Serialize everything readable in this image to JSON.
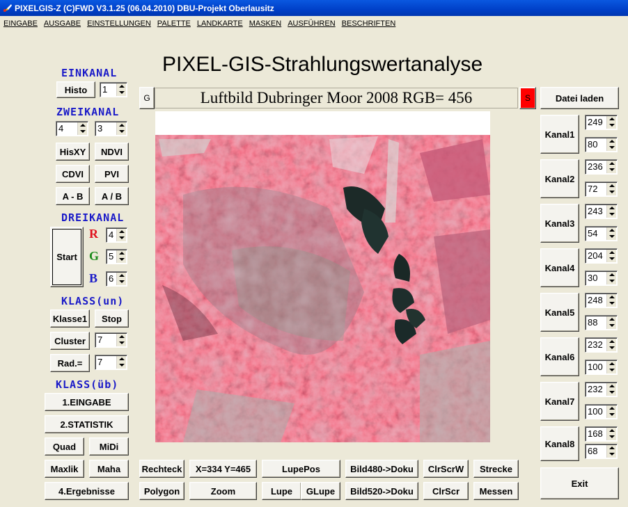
{
  "window": {
    "title": "PIXELGIS-Z (C)FWD V3.1.25 (06.04.2010)  DBU-Projekt Oberlausitz"
  },
  "menu": [
    "EINGABE",
    "AUSGABE",
    "EINSTELLUNGEN",
    "PALETTE",
    "LANDKARTE",
    "MASKEN",
    "AUSFÜHREN",
    "BESCHRIFTEN"
  ],
  "main_title": "PIXEL-GIS-Strahlungswertanalyse",
  "image": {
    "caption": "Luftbild Dubringer Moor 2008 RGB= 456",
    "g_label": "G",
    "s_label": "S"
  },
  "left": {
    "einkanal": "EINKANAL",
    "histo": "Histo",
    "histo_val": "1",
    "zweikanal": "ZWEIKANAL",
    "z1": "4",
    "z2": "3",
    "hisxy": "HisXY",
    "ndvi": "NDVI",
    "cdvi": "CDVI",
    "pvi": "PVI",
    "amb": "A - B",
    "adb": "A / B",
    "dreikanal": "DREIKANAL",
    "start": "Start",
    "r": "R",
    "g": "G",
    "b": "B",
    "r_val": "4",
    "g_val": "5",
    "b_val": "6",
    "klass_un": "KLASS(un)",
    "klasse1": "Klasse1",
    "stop": "Stop",
    "cluster": "Cluster",
    "cluster_val": "7",
    "rad": "Rad.=",
    "rad_val": "7",
    "klass_ub": "KLASS(üb)",
    "eingabe": "1.EINGABE",
    "statistik": "2.STATISTIK",
    "quad": "Quad",
    "midi": "MiDi",
    "maxlik": "Maxlik",
    "maha": "Maha",
    "ergebnisse": "4.Ergebnisse"
  },
  "bottom": {
    "rechteck": "Rechteck",
    "coords": "X=334 Y=465",
    "lupepos": "LupePos",
    "bild480": "Bild480->Doku",
    "clrscrw": "ClrScrW",
    "strecke": "Strecke",
    "polygon": "Polygon",
    "zoom": "Zoom",
    "lupe": "Lupe",
    "glupe": "GLupe",
    "bild520": "Bild520->Doku",
    "clrscr": "ClrScr",
    "messen": "Messen"
  },
  "right": {
    "datei_laden": "Datei laden",
    "channels": [
      {
        "label": "Kanal1",
        "max": "249",
        "min": "80"
      },
      {
        "label": "Kanal2",
        "max": "236",
        "min": "72"
      },
      {
        "label": "Kanal3",
        "max": "243",
        "min": "54"
      },
      {
        "label": "Kanal4",
        "max": "204",
        "min": "30"
      },
      {
        "label": "Kanal5",
        "max": "248",
        "min": "88"
      },
      {
        "label": "Kanal6",
        "max": "232",
        "min": "100"
      },
      {
        "label": "Kanal7",
        "max": "232",
        "min": "100"
      },
      {
        "label": "Kanal8",
        "max": "168",
        "min": "68"
      }
    ],
    "exit": "Exit"
  },
  "colors": {
    "accent_red": "#e0101c",
    "header_blue": "#1a1ac8",
    "g_green": "#1a8a1a"
  }
}
